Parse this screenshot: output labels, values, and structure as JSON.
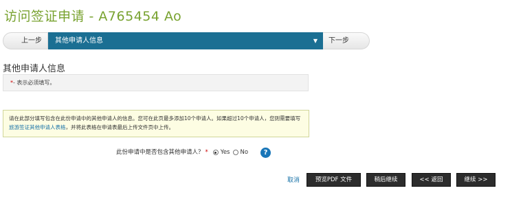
{
  "page": {
    "title": "访问签证申请 - A765454 Ao"
  },
  "nav": {
    "prev_label": "上一步",
    "current_section": "其他申请人信息",
    "next_label": "下一步"
  },
  "section": {
    "title": "其他申请人信息",
    "required_star": "*",
    "required_note": "- 表示必须填写。"
  },
  "info": {
    "text_1": "请在此部分填写包含在此份申请中的其他申请人的信息。您可在此页最多添加10个申请人。如果超过10个申请人，您则需要填写",
    "link_text": "旅游签证其他申请人表格",
    "text_2": "，并将此表格在申请表最后上传文件页中上传。"
  },
  "question": {
    "text": "此份申请中是否包含其他申请人？",
    "star": "*",
    "options": [
      "Yes",
      "No"
    ],
    "selected": "Yes",
    "help_symbol": "?"
  },
  "actions": {
    "cancel": "取消",
    "preview_pdf": "预览PDF 文件",
    "save_later": "稍后继续",
    "back": "<< 返回",
    "continue": "继续 >>"
  }
}
